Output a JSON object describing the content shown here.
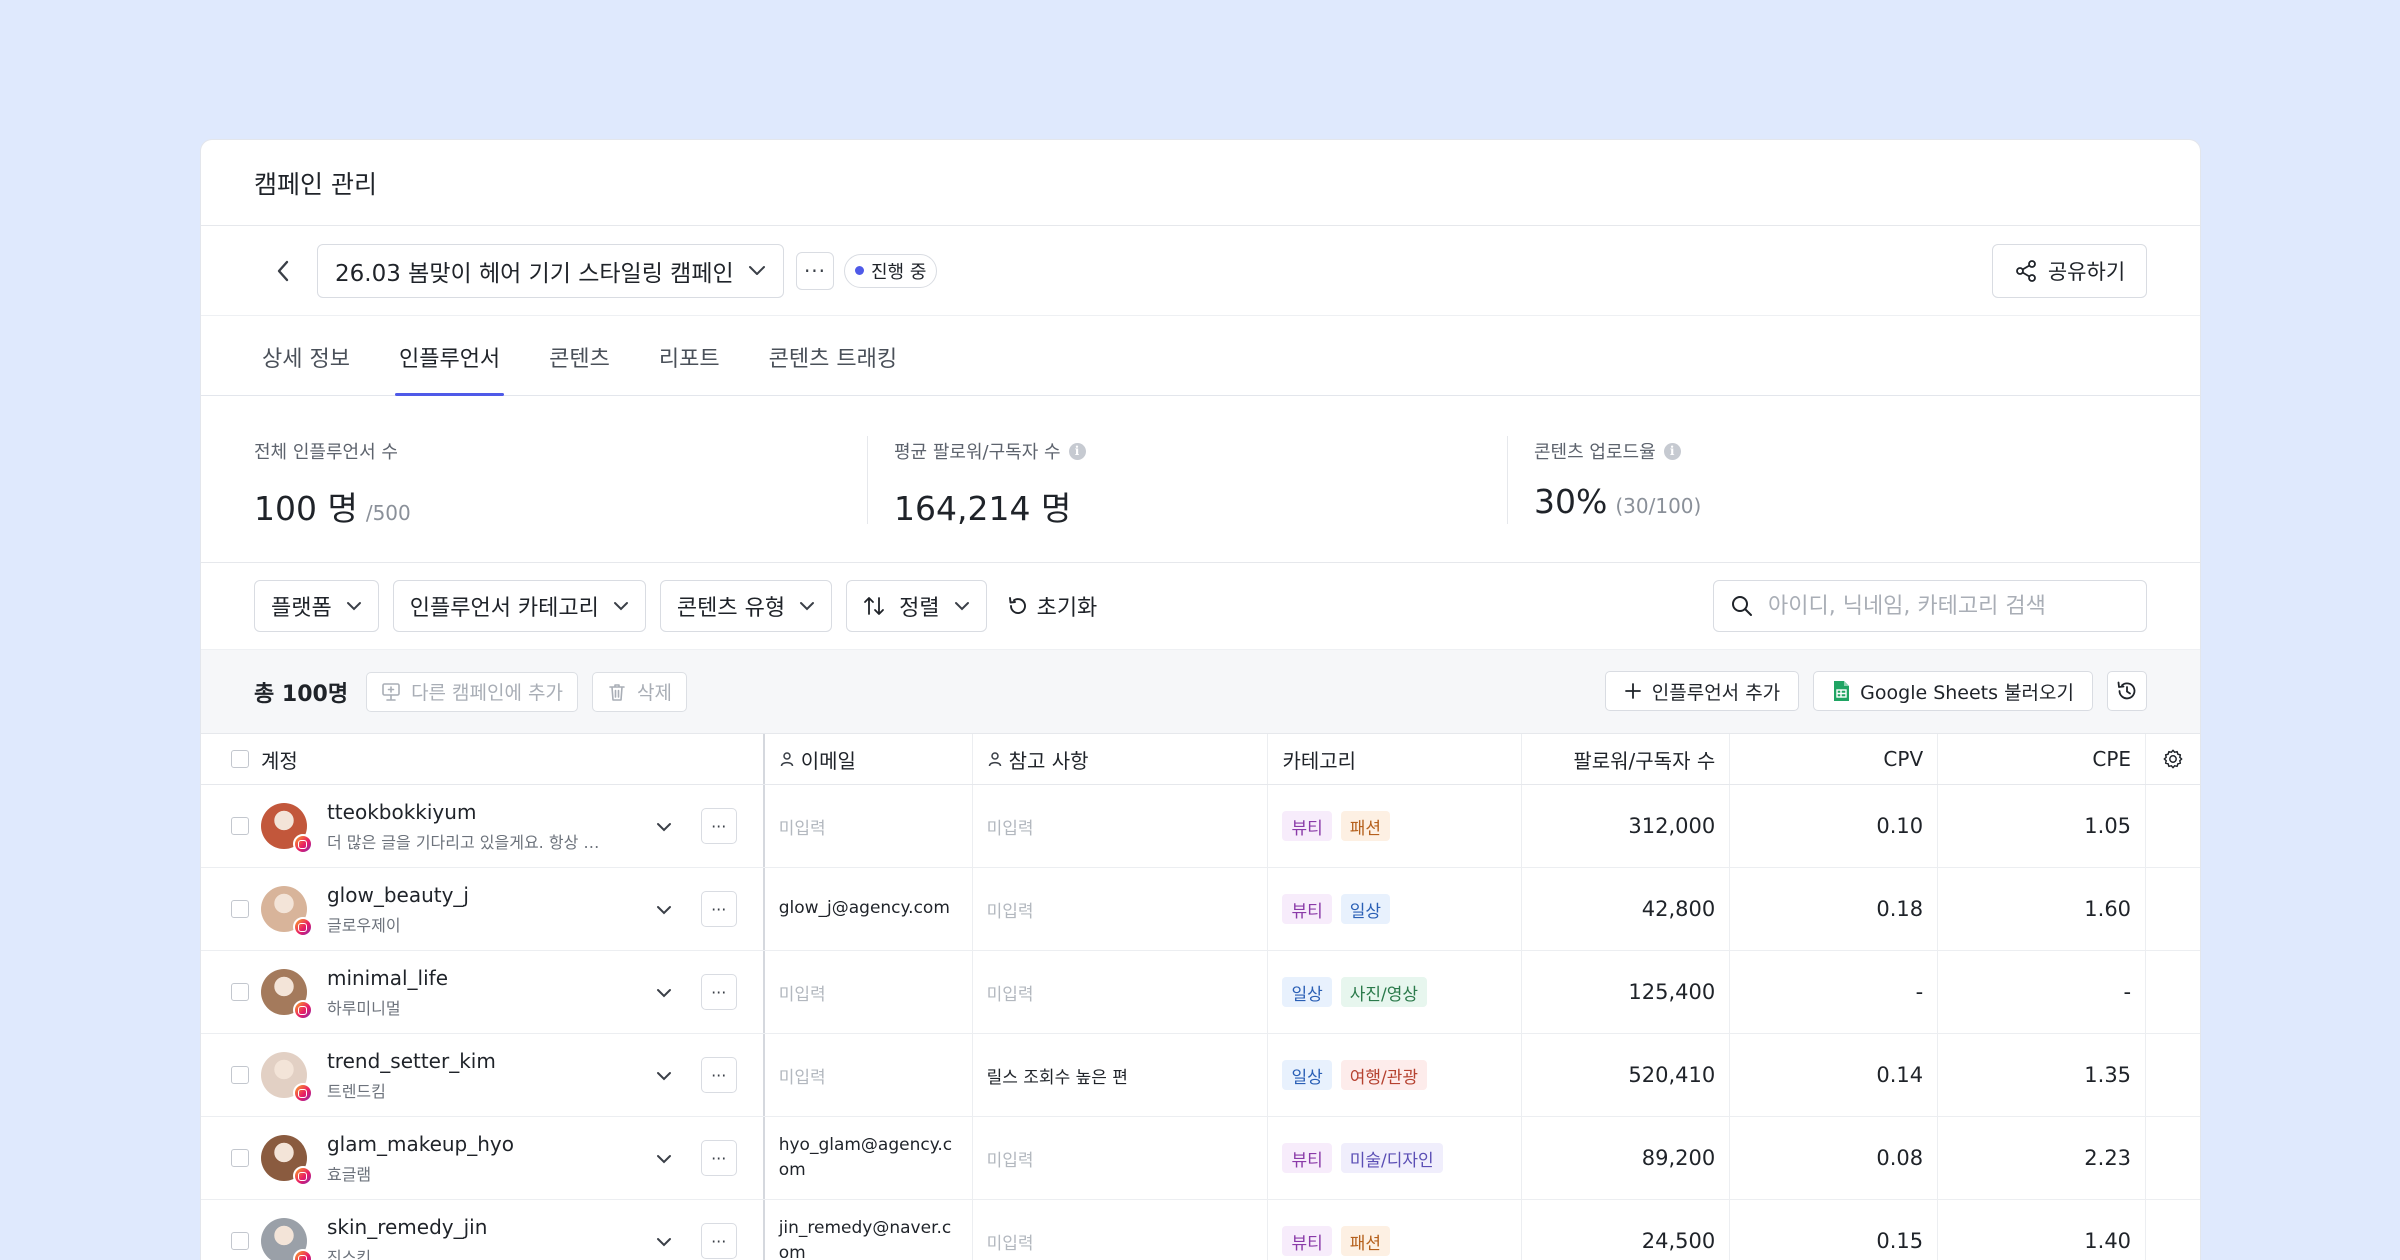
{
  "page": {
    "title": "캠페인 관리"
  },
  "campaign": {
    "name": "26.03 봄맞이 헤어 기기 스타일링 캠페인",
    "more_label": "···",
    "status": "진행 중",
    "share_label": "공유하기"
  },
  "tabs": [
    {
      "label": "상세 정보"
    },
    {
      "label": "인플루언서"
    },
    {
      "label": "콘텐츠"
    },
    {
      "label": "리포트"
    },
    {
      "label": "콘텐츠 트래킹"
    }
  ],
  "stats": [
    {
      "label": "전체 인플루언서 수",
      "value": "100 명",
      "sub": "/500"
    },
    {
      "label": "평균 팔로워/구독자 수",
      "value": "164,214 명",
      "sub": ""
    },
    {
      "label": "콘텐츠 업로드율",
      "value": "30%",
      "sub": "(30/100)"
    }
  ],
  "filters": {
    "platform": "플랫폼",
    "category": "인플루언서 카테고리",
    "content_type": "콘텐츠 유형",
    "sort": "정렬",
    "reset": "초기화",
    "search_placeholder": "아이디, 닉네임, 카테고리 검색"
  },
  "actions": {
    "total": "총 100명",
    "add_to_campaign": "다른 캠페인에 추가",
    "delete": "삭제",
    "add_influencer": "인플루언서 추가",
    "google_sheets": "Google Sheets 불러오기"
  },
  "table": {
    "headers": {
      "account": "계정",
      "email": "이메일",
      "note": "참고 사항",
      "category": "카테고리",
      "followers": "팔로워/구독자 수",
      "cpv": "CPV",
      "cpe": "CPE"
    },
    "rows": [
      {
        "id": "tteokbokkiyum",
        "sub": "더 많은 글을 기다리고 있을게요. 항상 유...",
        "email": "미입력",
        "note": "미입력",
        "cats": [
          "뷰티",
          "패션"
        ],
        "followers": "312,000",
        "cpv": "0.10",
        "cpe": "1.05"
      },
      {
        "id": "glow_beauty_j",
        "sub": "글로우제이",
        "email": "glow_j@agency.com",
        "note": "미입력",
        "cats": [
          "뷰티",
          "일상"
        ],
        "followers": "42,800",
        "cpv": "0.18",
        "cpe": "1.60"
      },
      {
        "id": "minimal_life",
        "sub": "하루미니멀",
        "email": "미입력",
        "note": "미입력",
        "cats": [
          "일상",
          "사진/영상"
        ],
        "followers": "125,400",
        "cpv": "-",
        "cpe": "-"
      },
      {
        "id": "trend_setter_kim",
        "sub": "트렌드킴",
        "email": "미입력",
        "note": "릴스 조회수 높은 편",
        "cats": [
          "일상",
          "여행/관광"
        ],
        "followers": "520,410",
        "cpv": "0.14",
        "cpe": "1.35"
      },
      {
        "id": "glam_makeup_hyo",
        "sub": "효글램",
        "email": "hyo_glam@agency.com",
        "note": "미입력",
        "cats": [
          "뷰티",
          "미술/디자인"
        ],
        "followers": "89,200",
        "cpv": "0.08",
        "cpe": "2.23"
      },
      {
        "id": "skin_remedy_jin",
        "sub": "진스킨",
        "email": "jin_remedy@naver.com",
        "note": "미입력",
        "cats": [
          "뷰티",
          "패션"
        ],
        "followers": "24,500",
        "cpv": "0.15",
        "cpe": "1.40"
      }
    ]
  },
  "chip_colors": {
    "뷰티": {
      "bg": "#f7ecfb",
      "fg": "#8a3aa8"
    },
    "패션": {
      "bg": "#fdf0e3",
      "fg": "#b5601c"
    },
    "일상": {
      "bg": "#e8f1fd",
      "fg": "#2a5fb5"
    },
    "사진/영상": {
      "bg": "#e7f6ee",
      "fg": "#2b7a4b"
    },
    "여행/관광": {
      "bg": "#fdeceb",
      "fg": "#b54230"
    },
    "미술/디자인": {
      "bg": "#f0eefc",
      "fg": "#5b4fb5"
    }
  },
  "avatar_colors": [
    "#c2573b",
    "#d8b49a",
    "#a47a5c",
    "#e2d0c4",
    "#8a5b3f",
    "#9aa0a8"
  ]
}
